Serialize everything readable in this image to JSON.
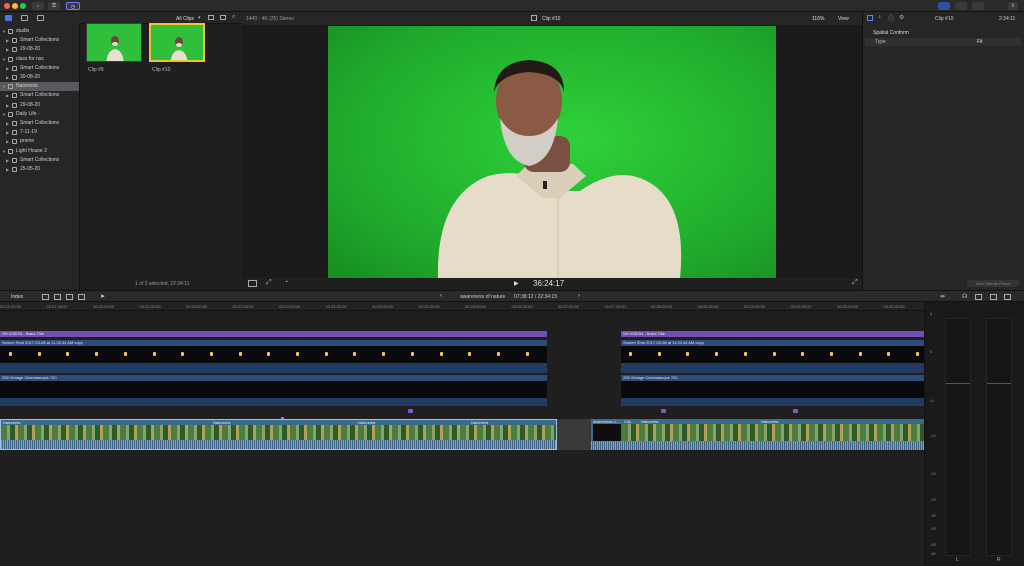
{
  "browser": {
    "filter_label": "All Clips",
    "libraries": [
      {
        "label": "studio",
        "level": 0
      },
      {
        "label": "Smart Collections",
        "level": 1
      },
      {
        "label": "29-08-20",
        "level": 1
      },
      {
        "label": "class for nac",
        "level": 0
      },
      {
        "label": "Smart Collections",
        "level": 1
      },
      {
        "label": "30-08-20",
        "level": 1
      },
      {
        "label": "Natureela",
        "level": 0,
        "selected": true
      },
      {
        "label": "Smart Collections",
        "level": 1
      },
      {
        "label": "29-08-20",
        "level": 1
      },
      {
        "label": "Daily Life -",
        "level": 0
      },
      {
        "label": "Smart Collections",
        "level": 1
      },
      {
        "label": "7-11-19",
        "level": 1
      },
      {
        "label": "promo",
        "level": 1
      },
      {
        "label": "Light House 2",
        "level": 0
      },
      {
        "label": "Smart Collections",
        "level": 1
      },
      {
        "label": "25-05-20",
        "level": 1
      }
    ],
    "clips": [
      {
        "label": "Clip #9"
      },
      {
        "label": "Clip #10"
      }
    ],
    "status": "1 of 2 selected, 22:34:11"
  },
  "viewer": {
    "format": "1440 - 4K (25) Stereo",
    "clip_name": "Clip #10",
    "zoom": "116%",
    "view_label": "View",
    "timecode": "36:24:17"
  },
  "inspector": {
    "clip_name": "Clip #10",
    "duration": "2:34:11",
    "section": "Spatial Conform",
    "type_label": "Type",
    "type_value": "Fit",
    "save_button": "Save Effects Preset"
  },
  "timeline": {
    "index_label": "Index",
    "project_name": "awareness of nature",
    "project_time": "07:38:12 / 22:34:15",
    "ruler_ticks": [
      "00:21:00:00",
      "00:21:30:00",
      "00:22:00:00",
      "00:22:30:00",
      "00:23:00:00",
      "00:23:30:00",
      "00:24:00:00",
      "00:24:30:00",
      "00:25:00:00",
      "00:25:30:00",
      "00:26:00:00",
      "00:26:30:00",
      "00:27:00:00",
      "00:27:30:00",
      "00:28:00:00",
      "00:28:30:00",
      "00:29:00:00",
      "00:29:30:00",
      "00:30:00:00",
      "00:30:30:00"
    ],
    "title_left": "SH VISION - Basic Title",
    "title_right": "SH VISION - Basic Title",
    "screenshot_left": "Screen Shot 2017-03-08 at 11.20.44 AM copy",
    "screenshot_right": "Screen Shot 2017-03-08 at 11.20.44 AM copy",
    "vintage_left": "255 Vintage Cinemascope 720",
    "vintage_right": "255 Vintage Cinemascope 720",
    "clip_labels": [
      "Natureela",
      "Natureela",
      "Natureela",
      "Natureela",
      "awareness o...",
      "Clip",
      "Natureela",
      "Natureela"
    ]
  },
  "meters": {
    "scale": [
      "6",
      "0",
      "-6",
      "-12",
      "-18",
      "-20",
      "-30",
      "-40",
      "-50",
      "-60"
    ],
    "left": "L",
    "right": "R"
  }
}
